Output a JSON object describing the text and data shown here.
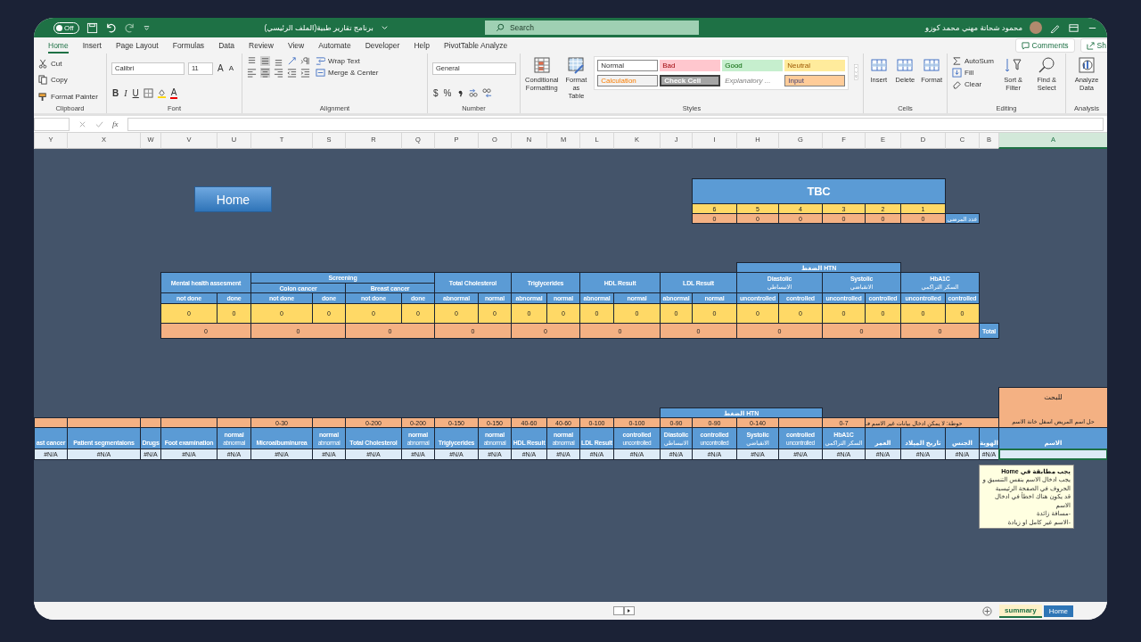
{
  "title_bar": {
    "autosave": "Off",
    "document_title": "برنامج تقارير طبية(الملف الرئيسي)",
    "search_placeholder": "Search",
    "user_name": "محمود شحاتة مهني محمد كوزو"
  },
  "ribbon_tabs": [
    {
      "label": "Home",
      "selected": true
    },
    {
      "label": "Insert",
      "selected": false
    },
    {
      "label": "Page Layout",
      "selected": false
    },
    {
      "label": "Formulas",
      "selected": false
    },
    {
      "label": "Data",
      "selected": false
    },
    {
      "label": "Review",
      "selected": false
    },
    {
      "label": "View",
      "selected": false
    },
    {
      "label": "Automate",
      "selected": false
    },
    {
      "label": "Developer",
      "selected": false
    },
    {
      "label": "Help",
      "selected": false
    },
    {
      "label": "PivotTable Analyze",
      "selected": false
    }
  ],
  "ribbon_actions": {
    "comments": "Comments",
    "share": "Sh"
  },
  "clipboard": {
    "cut": "Cut",
    "copy": "Copy",
    "format_painter": "Format Painter",
    "label": "Clipboard"
  },
  "font": {
    "name": "Calibri",
    "size": "11",
    "grow": "A",
    "shrink": "A",
    "bold": "B",
    "italic": "I",
    "underline": "U",
    "font_color": "A",
    "label": "Font"
  },
  "alignment": {
    "wrap_text": "Wrap Text",
    "merge_center": "Merge & Center",
    "label": "Alignment"
  },
  "number": {
    "format": "General",
    "currency": "$",
    "percent": "%",
    "label": "Number"
  },
  "styles": {
    "conditional_formatting": "Conditional Formatting",
    "format_as_table": "Format as Table",
    "label": "Styles",
    "cell_styles": [
      {
        "label": "Normal",
        "kind": "normal"
      },
      {
        "label": "Bad",
        "kind": "bad"
      },
      {
        "label": "Good",
        "kind": "good"
      },
      {
        "label": "Neutral",
        "kind": "neutral"
      },
      {
        "label": "Calculation",
        "kind": "calculation"
      },
      {
        "label": "Check Cell",
        "kind": "check"
      },
      {
        "label": "Explanatory ...",
        "kind": "explanatory"
      },
      {
        "label": "Input",
        "kind": "input"
      }
    ]
  },
  "cells": {
    "buttons": [
      "Insert",
      "Delete",
      "Format"
    ],
    "label": "Cells"
  },
  "editing": {
    "autosum": "AutoSum",
    "fill": "Fill",
    "clear": "Clear",
    "sort_filter": "Sort & Filter",
    "find_select": "Find & Select",
    "label": "Editing"
  },
  "analysis": {
    "analyze_data": "Analyze Data",
    "label": "Analysis"
  },
  "formula_bar": {
    "function_label": "fx"
  },
  "column_headers": [
    {
      "label": "Y",
      "selected": false
    },
    {
      "label": "X",
      "selected": false
    },
    {
      "label": "W",
      "selected": false
    },
    {
      "label": "V",
      "selected": false
    },
    {
      "label": "U",
      "selected": false
    },
    {
      "label": "T",
      "selected": false
    },
    {
      "label": "S",
      "selected": false
    },
    {
      "label": "R",
      "selected": false
    },
    {
      "label": "Q",
      "selected": false
    },
    {
      "label": "P",
      "selected": false
    },
    {
      "label": "O",
      "selected": false
    },
    {
      "label": "N",
      "selected": false
    },
    {
      "label": "M",
      "selected": false
    },
    {
      "label": "L",
      "selected": false
    },
    {
      "label": "K",
      "selected": false
    },
    {
      "label": "J",
      "selected": false
    },
    {
      "label": "I",
      "selected": false
    },
    {
      "label": "H",
      "selected": false
    },
    {
      "label": "G",
      "selected": false
    },
    {
      "label": "F",
      "selected": false
    },
    {
      "label": "E",
      "selected": false
    },
    {
      "label": "D",
      "selected": false
    },
    {
      "label": "C",
      "selected": false
    },
    {
      "label": "B",
      "selected": false
    },
    {
      "label": "A",
      "selected": true
    }
  ],
  "home_button": "Home",
  "tbc_table": {
    "title": "TBC",
    "numbers": [
      "6",
      "5",
      "4",
      "3",
      "2",
      "1"
    ],
    "counts": [
      "0",
      "0",
      "0",
      "0",
      "0",
      "0"
    ],
    "row_label": "عدد المرضى"
  },
  "summary_table": {
    "total_label": "Total",
    "sections": [
      {
        "kind": "single",
        "title": "Mental health assesment",
        "columns": [
          {
            "label": "not done",
            "count": "0"
          },
          {
            "label": "done",
            "count": "0"
          }
        ],
        "total": "0"
      },
      {
        "kind": "split",
        "band": "Screening",
        "groups": [
          {
            "title": "Colon cancer",
            "columns": [
              {
                "label": "not done",
                "count": "0"
              },
              {
                "label": "done",
                "count": "0"
              }
            ],
            "total": "0"
          },
          {
            "title": "Breast cancer",
            "columns": [
              {
                "label": "not done",
                "count": "0"
              },
              {
                "label": "done",
                "count": "0"
              }
            ],
            "total": "0"
          }
        ]
      },
      {
        "kind": "single",
        "title": "Total Cholesterol",
        "columns": [
          {
            "label": "abnormal",
            "count": "0"
          },
          {
            "label": "normal",
            "count": "0"
          }
        ],
        "total": "0"
      },
      {
        "kind": "single",
        "title": "Triglycerides",
        "columns": [
          {
            "label": "abnormal",
            "count": "0"
          },
          {
            "label": "normal",
            "count": "0"
          }
        ],
        "total": "0"
      },
      {
        "kind": "single",
        "title": "HDL Result",
        "columns": [
          {
            "label": "abnormal",
            "count": "0"
          },
          {
            "label": "normal",
            "count": "0"
          }
        ],
        "total": "0"
      },
      {
        "kind": "single",
        "title": "LDL Result",
        "columns": [
          {
            "label": "abnormal",
            "count": "0"
          },
          {
            "label": "normal",
            "count": "0"
          }
        ],
        "total": "0"
      },
      {
        "kind": "overhead",
        "band": "الضغط HTN",
        "subtitles_rtl": [
          "الانقباضي",
          "الانبساطي"
        ],
        "groups": [
          {
            "title": "Diastolic",
            "columns": [
              {
                "label": "uncontrolled",
                "count": "0"
              },
              {
                "label": "controlled",
                "count": "0"
              }
            ],
            "total": "0"
          },
          {
            "title": "Systolic",
            "columns": [
              {
                "label": "uncontrolled",
                "count": "0"
              },
              {
                "label": "controlled",
                "count": "0"
              }
            ],
            "total": "0"
          }
        ]
      },
      {
        "kind": "single",
        "title": "HbA1C",
        "subtitle": "السكر التراكمي",
        "columns": [
          {
            "label": "uncontrolled",
            "count": "0"
          },
          {
            "label": "controlled",
            "count": "0"
          }
        ],
        "total": "0"
      }
    ]
  },
  "patient_table": {
    "band": "الضغط HTN",
    "note": "حوطة: لا يمكن ادخال بيانات غير الاسم فـ",
    "search_box": {
      "title": "للبحث",
      "text": "حل اسم المريض اسفل خانة الاسم"
    },
    "columns": [
      {
        "label": "ast cancer",
        "value": "#N/A"
      },
      {
        "label": "Patient segmentaions",
        "value": "#N/A"
      },
      {
        "label": "Drugs",
        "value": "#N/A"
      },
      {
        "label": "Foot examination",
        "value": "#N/A"
      },
      {
        "label": "normal",
        "label_2": "abnormal",
        "value": "#N/A"
      },
      {
        "label": "Microalbuminurea",
        "range": "0-30",
        "value": "#N/A"
      },
      {
        "label": "normal",
        "label_2": "abnormal",
        "value": "#N/A"
      },
      {
        "label": "Total Cholesterol",
        "range": "0-200",
        "value": "#N/A"
      },
      {
        "label": "normal",
        "label_2": "abnormal",
        "range": "0-200",
        "value": "#N/A"
      },
      {
        "label": "Triglycerides",
        "range": "0-150",
        "value": "#N/A"
      },
      {
        "label": "normal",
        "label_2": "abnormal",
        "range": "0-150",
        "value": "#N/A"
      },
      {
        "label": "HDL Result",
        "range": "40-60",
        "value": "#N/A"
      },
      {
        "label": "normal",
        "label_2": "abnormal",
        "range": "40-60",
        "value": "#N/A"
      },
      {
        "label": "LDL Result",
        "range": "0-100",
        "value": "#N/A"
      },
      {
        "label": "controlled",
        "label_2": "uncontrolled",
        "range": "0-100",
        "value": "#N/A"
      },
      {
        "label": "Diastolic",
        "label_2": "الانبساطي",
        "range": "0-90",
        "value": "#N/A"
      },
      {
        "label": "controlled",
        "label_2": "uncontrolled",
        "range": "0-90",
        "value": "#N/A"
      },
      {
        "label": "Systolic",
        "label_2": "الانقباضي",
        "range": "0-140",
        "value": "#N/A"
      },
      {
        "label": "controlled",
        "label_2": "uncontrolled",
        "value": "#N/A"
      },
      {
        "label": "HbA1C",
        "label_2": "السكر التراكمي",
        "range": "0-7",
        "value": "#N/A"
      },
      {
        "label": "العمر",
        "value": "#N/A"
      },
      {
        "label": "تاريخ الميلاد",
        "value": "#N/A"
      },
      {
        "label": "الجنس",
        "value": "#N/A"
      },
      {
        "label": "الهوية",
        "value": "#N/A"
      }
    ],
    "name_column": {
      "label": "الاسم",
      "selected": true
    }
  },
  "comment": {
    "title": "يجب مطابقة في Home",
    "lines": [
      "يجب ادخال الاسم بنفس التنسيق و الحروف في الصفحة الرئيسية",
      "قد يكون هناك اخطأ في ادخال الاسم",
      "-مسافة زائدة",
      "-الاسم غير كامل او زيادة"
    ]
  },
  "sheet_tabs": [
    {
      "label": "summary",
      "selected": true
    },
    {
      "label": "Home",
      "selected": false
    }
  ]
}
